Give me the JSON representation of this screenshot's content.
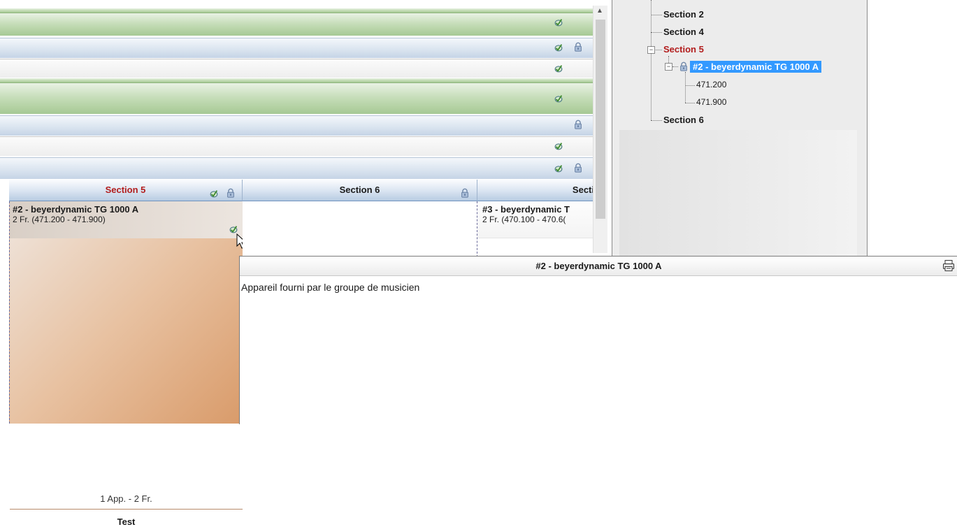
{
  "grid_columns": {
    "section5": {
      "label": "Section 5",
      "color": "#b21c1c"
    },
    "section6": {
      "label": "Section 6"
    },
    "section7": {
      "label": "Secti"
    }
  },
  "section5_card": {
    "title": "#2 - beyerdynamic TG 1000 A",
    "subtitle": "2 Fr.  (471.200 - 471.900)",
    "summary": "1 App. - 2 Fr.",
    "group_name": "Test"
  },
  "section7_card": {
    "title": "#3 - beyerdynamic T",
    "subtitle": "2 Fr.  (470.100 - 470.6("
  },
  "tree": {
    "items": [
      {
        "label": "Section 2"
      },
      {
        "label": "Section 4"
      },
      {
        "label": "Section 5",
        "color": "#b21c1c"
      },
      {
        "label": "#2 - beyerdynamic TG 1000 A",
        "selected": true
      },
      {
        "label": "471.200"
      },
      {
        "label": "471.900"
      },
      {
        "label": "Section 6"
      }
    ]
  },
  "popup": {
    "title": "#2 - beyerdynamic TG 1000 A",
    "note": "Appareil fourni par le groupe de musicien"
  },
  "colors": {
    "accent": "#3399ff",
    "section_red": "#b21c1c"
  },
  "icons": [
    "check-icon",
    "lock-icon",
    "print-icon",
    "cursor-icon",
    "collapse-icon"
  ]
}
